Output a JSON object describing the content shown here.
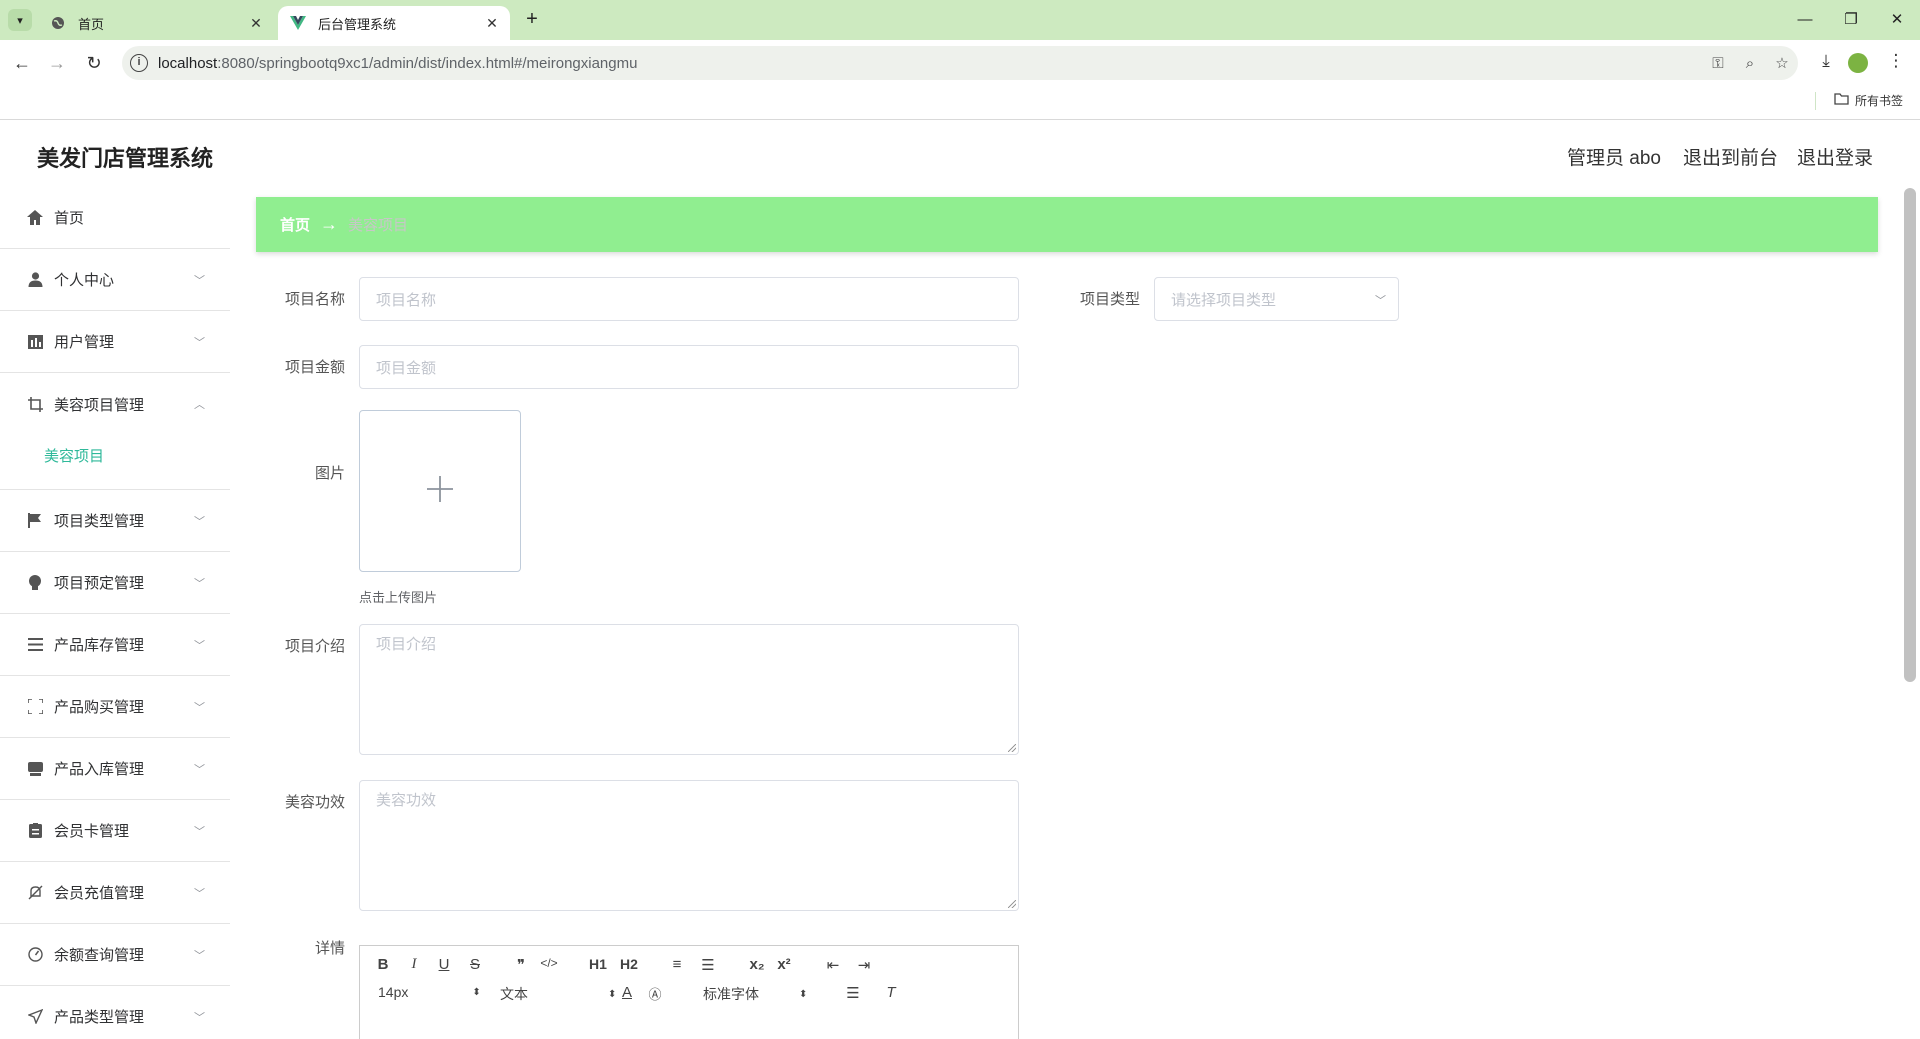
{
  "browser": {
    "tabs": [
      {
        "title": "首页",
        "active": false
      },
      {
        "title": "后台管理系统",
        "active": true
      }
    ],
    "url_host": "localhost",
    "url_rest": ":8080/springbootq9xc1/admin/dist/index.html#/meirongxiangmu",
    "bookmarks_label": "所有书签",
    "window_controls": {
      "minimize": "—",
      "restore": "❐",
      "close": "✕"
    }
  },
  "app": {
    "title": "美发门店管理系统",
    "header_links": {
      "admin": "管理员 abo",
      "to_front": "退出到前台",
      "logout": "退出登录"
    }
  },
  "sidebar": {
    "items": [
      {
        "label": "首页",
        "icon": "home-icon",
        "arrow": ""
      },
      {
        "label": "个人中心",
        "icon": "user-icon",
        "arrow": "﹀"
      },
      {
        "label": "用户管理",
        "icon": "chart-icon",
        "arrow": "﹀"
      },
      {
        "label": "美容项目管理",
        "icon": "crop-icon",
        "arrow": "︿"
      },
      {
        "label": "项目类型管理",
        "icon": "flag-icon",
        "arrow": "﹀"
      },
      {
        "label": "项目预定管理",
        "icon": "bulb-icon",
        "arrow": "﹀"
      },
      {
        "label": "产品库存管理",
        "icon": "list-icon",
        "arrow": "﹀"
      },
      {
        "label": "产品购买管理",
        "icon": "scan-icon",
        "arrow": "﹀"
      },
      {
        "label": "产品入库管理",
        "icon": "box-icon",
        "arrow": "﹀"
      },
      {
        "label": "会员卡管理",
        "icon": "card-icon",
        "arrow": "﹀"
      },
      {
        "label": "会员充值管理",
        "icon": "bell-off-icon",
        "arrow": "﹀"
      },
      {
        "label": "余额查询管理",
        "icon": "gauge-icon",
        "arrow": "﹀"
      },
      {
        "label": "产品类型管理",
        "icon": "send-icon",
        "arrow": "﹀"
      }
    ],
    "sub_item": "美容项目",
    "accent": "#2fb99a"
  },
  "breadcrumb": {
    "home": "首页",
    "separator": "→",
    "current": "美容项目",
    "bg": "#90ee90"
  },
  "form": {
    "name": {
      "label": "项目名称",
      "placeholder": "项目名称"
    },
    "type": {
      "label": "项目类型",
      "placeholder": "请选择项目类型"
    },
    "amount": {
      "label": "项目金额",
      "placeholder": "项目金额"
    },
    "image": {
      "label": "图片",
      "tip": "点击上传图片"
    },
    "intro": {
      "label": "项目介绍",
      "placeholder": "项目介绍"
    },
    "effect": {
      "label": "美容功效",
      "placeholder": "美容功效"
    },
    "detail": {
      "label": "详情"
    }
  },
  "editor": {
    "buttons": [
      "B",
      "I",
      "U",
      "S",
      "❞",
      "</>",
      "H1",
      "H2",
      "≡",
      "☰",
      "x₂",
      "x²",
      "⇤",
      "⇥"
    ],
    "size": "14px",
    "header": "文本",
    "font": "标准字体"
  }
}
